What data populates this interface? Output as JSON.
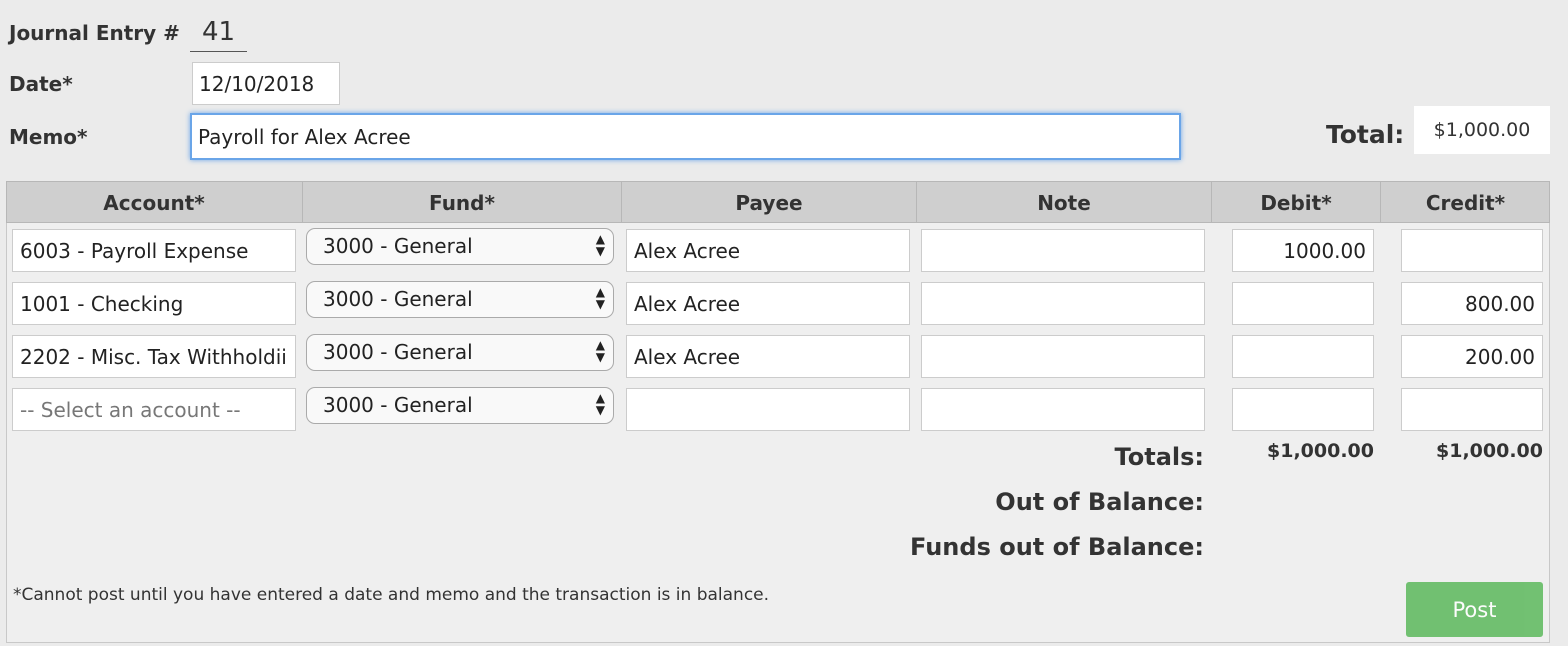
{
  "header": {
    "journal_label": "Journal Entry #",
    "journal_number": "41",
    "date_label": "Date*",
    "date_value": "12/10/2018",
    "memo_label": "Memo*",
    "memo_value": "Payroll for Alex Acree",
    "total_label": "Total:",
    "total_value": "$1,000.00"
  },
  "table": {
    "columns": [
      "Account*",
      "Fund*",
      "Payee",
      "Note",
      "Debit*",
      "Credit*"
    ],
    "rows": [
      {
        "account": "6003 - Payroll Expense",
        "fund": "3000 - General",
        "payee": "Alex Acree",
        "note": "",
        "debit": "1000.00",
        "credit": ""
      },
      {
        "account": "1001 - Checking",
        "fund": "3000 - General",
        "payee": "Alex Acree",
        "note": "",
        "debit": "",
        "credit": "800.00"
      },
      {
        "account": "2202 - Misc. Tax Withholdii",
        "fund": "3000 - General",
        "payee": "Alex Acree",
        "note": "",
        "debit": "",
        "credit": "200.00"
      },
      {
        "account": "",
        "account_placeholder": "-- Select an account --",
        "fund": "3000 - General",
        "payee": "",
        "note": "",
        "debit": "",
        "credit": ""
      }
    ]
  },
  "summary": {
    "totals_label": "Totals:",
    "debit_total": "$1,000.00",
    "credit_total": "$1,000.00",
    "out_of_balance_label": "Out of Balance:",
    "funds_out_of_balance_label": "Funds out of Balance:"
  },
  "footnote": "*Cannot post until you have entered a date and memo and the transaction is in balance.",
  "post_button": "Post",
  "colors": {
    "post_button": "#5cb85c",
    "memo_focus": "#6aa5e8",
    "header_bg": "#cfcfcf"
  }
}
